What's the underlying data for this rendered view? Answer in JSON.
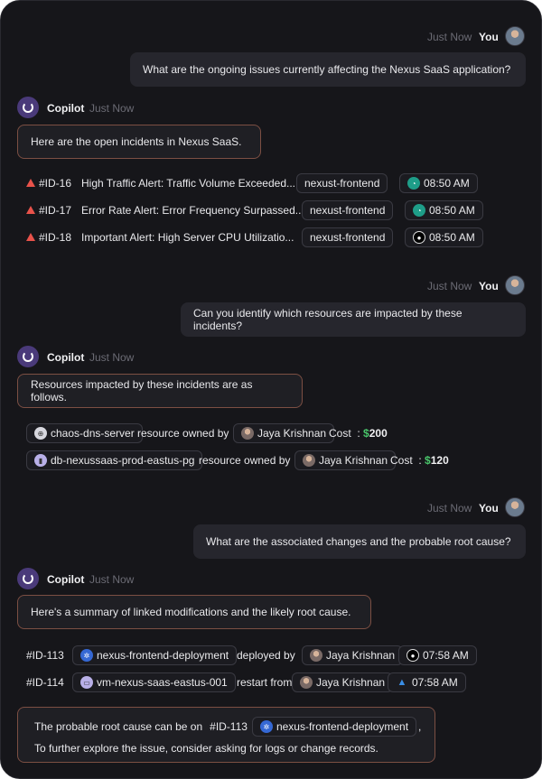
{
  "conversation": {
    "you_label": "You",
    "bot_name": "Copilot",
    "time_label": "Just Now",
    "q1": "What are the ongoing issues currently affecting the Nexus SaaS application?",
    "a1": "Here are the open incidents in Nexus SaaS.",
    "incidents": [
      {
        "id": "#ID-16",
        "title": "High Traffic Alert: Traffic Volume Exceeded...",
        "tag": "nexust-frontend",
        "time": "08:50 AM",
        "source_icon": "monitor-icon"
      },
      {
        "id": "#ID-17",
        "title": "Error Rate Alert: Error Frequency Surpassed...",
        "tag": "nexust-frontend",
        "time": "08:50 AM",
        "source_icon": "monitor-icon"
      },
      {
        "id": "#ID-18",
        "title": "Important Alert: High Server CPU Utilizatio...",
        "tag": "nexust-frontend",
        "time": "08:50 AM",
        "source_icon": "github-icon"
      }
    ],
    "q2": "Can you identify which resources are impacted by these incidents?",
    "a2": "Resources impacted by these incidents are as follows.",
    "resources": [
      {
        "name": "chaos-dns-server",
        "owned_text": "resource owned by",
        "owner": "Jaya Krishnan",
        "cost_label": "Cost",
        "cost_colon": ":",
        "cost_currency": "$",
        "cost_value": "200"
      },
      {
        "name": "db-nexussaas-prod-eastus-pg",
        "owned_text": "resource owned by",
        "owner": "Jaya Krishnan",
        "cost_label": "Cost",
        "cost_colon": ":",
        "cost_currency": "$",
        "cost_value": "120"
      }
    ],
    "q3": "What are the associated changes and the probable root cause?",
    "a3": "Here's a summary of linked modifications and the likely root cause.",
    "changes": [
      {
        "id": "#ID-113",
        "resource": "nexus-frontend-deployment",
        "action": "deployed by",
        "person": "Jaya Krishnan",
        "time": "07:58 AM",
        "source_icon": "github-icon"
      },
      {
        "id": "#ID-114",
        "resource": "vm-nexus-saas-eastus-001",
        "action": "restart from",
        "person": "Jaya Krishnan",
        "time": "07:58 AM",
        "source_icon": "azure-icon"
      }
    ],
    "summary": {
      "prefix": "The probable root cause can be on",
      "id": "#ID-113",
      "resource": "nexus-frontend-deployment",
      "suffix": ",",
      "line2": "To further explore the issue, consider asking for logs or change records."
    }
  },
  "colors": {
    "background": "#16161a",
    "accent_border": "#7c4f43",
    "alert": "#e8524a",
    "cost": "#49c46a",
    "bot_logo": "#4a3a7a"
  }
}
